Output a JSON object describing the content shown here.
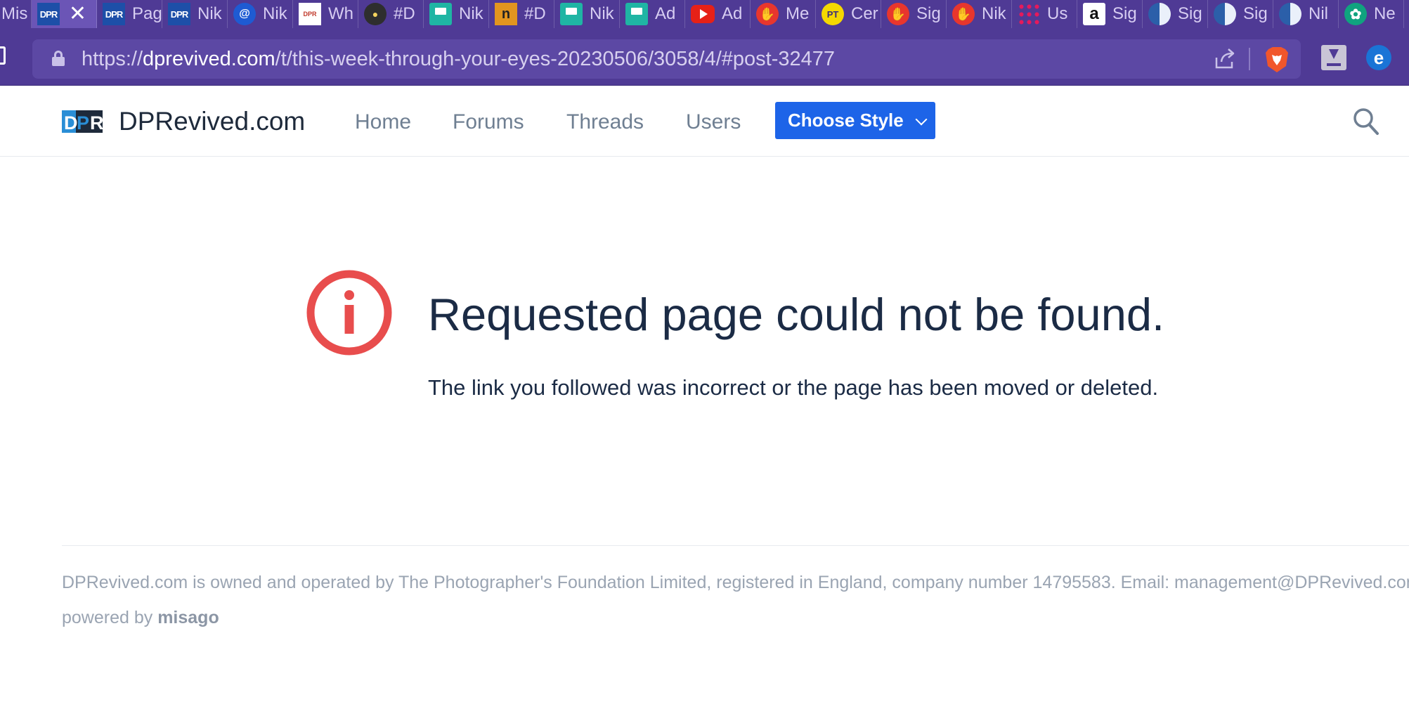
{
  "browser": {
    "tabs": [
      {
        "label": "Mis",
        "icon": "tab-icon-default",
        "active": false
      },
      {
        "label": "",
        "icon": "dpr-logo-icon",
        "active": true
      },
      {
        "label": "Pag",
        "icon": "dpr-logo-icon",
        "active": false
      },
      {
        "label": "Nik",
        "icon": "dpr-logo-icon",
        "active": false
      },
      {
        "label": "Nik",
        "icon": "blue-swirl-icon",
        "active": false
      },
      {
        "label": "Wh",
        "icon": "dpr-forum-icon",
        "active": false
      },
      {
        "label": "#D",
        "icon": "globe-badge-icon",
        "active": false
      },
      {
        "label": "Nik",
        "icon": "save-disk-icon",
        "active": false
      },
      {
        "label": "#D",
        "icon": "n-letter-icon",
        "active": false
      },
      {
        "label": "Nik",
        "icon": "save-disk-icon",
        "active": false
      },
      {
        "label": "Ad",
        "icon": "save-disk-icon",
        "active": false
      },
      {
        "label": "Ad",
        "icon": "youtube-icon",
        "active": false
      },
      {
        "label": "Me",
        "icon": "red-hand-icon",
        "active": false
      },
      {
        "label": "Cer",
        "icon": "pt-badge-icon",
        "active": false
      },
      {
        "label": "Sig",
        "icon": "red-hand-icon",
        "active": false
      },
      {
        "label": "Nik",
        "icon": "red-hand-icon",
        "active": false
      },
      {
        "label": "Us",
        "icon": "pink-dots-icon",
        "active": false
      },
      {
        "label": "Sig",
        "icon": "amazon-icon",
        "active": false
      },
      {
        "label": "Sig",
        "icon": "half-circle-icon",
        "active": false
      },
      {
        "label": "Sig",
        "icon": "half-circle-icon",
        "active": false
      },
      {
        "label": "Nil",
        "icon": "half-circle-icon",
        "active": false
      },
      {
        "label": "Ne",
        "icon": "chatgpt-icon",
        "active": false
      }
    ],
    "close_glyph": "✕",
    "url_prefix": "https://",
    "url_domain": "dprevived.com",
    "url_path": "/t/this-week-through-your-eyes-20230506/3058/4/#post-32477"
  },
  "site": {
    "logo_text": "DPR",
    "brand": "DPRevived.com",
    "nav": [
      "Home",
      "Forums",
      "Threads",
      "Users"
    ],
    "style_button": "Choose Style",
    "accent_color": "#1d64e8"
  },
  "error": {
    "title": "Requested page could not be found.",
    "message": "The link you followed was incorrect or the page has been moved or deleted.",
    "icon": "info-circle-icon",
    "icon_color": "#e84d4d"
  },
  "footer": {
    "text": "DPRevived.com is owned and operated by The Photographer's Foundation Limited, registered in England, company number 14795583. Email: management@DPRevived.com",
    "powered_prefix": "powered by",
    "powered_link": "misago"
  }
}
